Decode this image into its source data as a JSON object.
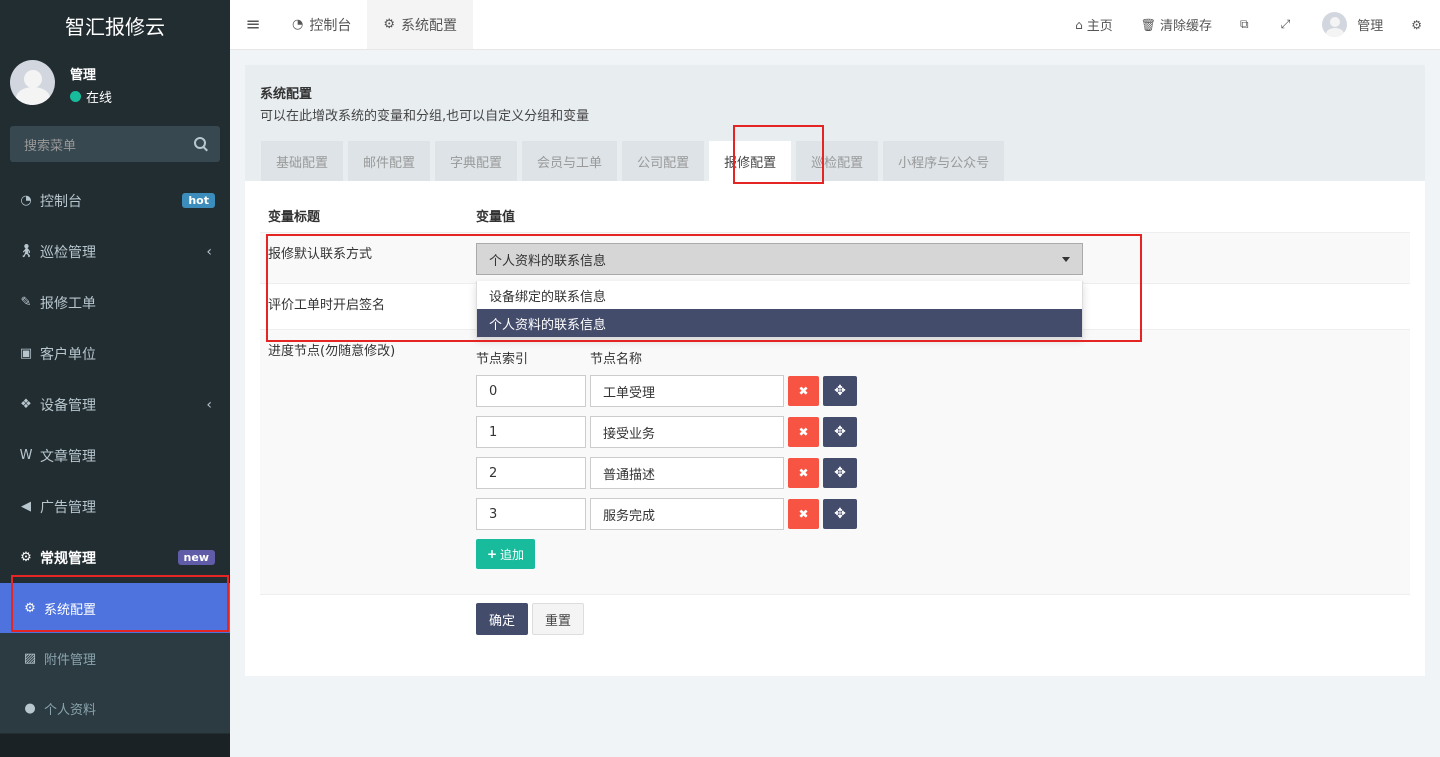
{
  "app": {
    "brand": "智汇报修云"
  },
  "user": {
    "name": "管理",
    "status": "在线"
  },
  "search": {
    "placeholder": "搜索菜单"
  },
  "sidebar": {
    "items": [
      {
        "label": "控制台",
        "badge": "hot",
        "icon": "dashboard-icon"
      },
      {
        "label": "巡检管理",
        "icon": "walk-icon"
      },
      {
        "label": "报修工单",
        "icon": "wrench-icon"
      },
      {
        "label": "客户单位",
        "icon": "contact-icon"
      },
      {
        "label": "设备管理",
        "icon": "cubes-icon"
      },
      {
        "label": "文章管理",
        "icon": "wordpress-icon"
      },
      {
        "label": "广告管理",
        "icon": "volume-icon"
      },
      {
        "label": "常规管理",
        "badge": "new",
        "icon": "gears-icon"
      }
    ],
    "subitems": [
      {
        "label": "系统配置",
        "icon": "gear-icon"
      },
      {
        "label": "附件管理",
        "icon": "image-icon"
      },
      {
        "label": "个人资料",
        "icon": "user-icon"
      }
    ]
  },
  "topbar": {
    "tabs": [
      {
        "label": "控制台",
        "icon": "dashboard-icon"
      },
      {
        "label": "系统配置",
        "icon": "gear-icon"
      }
    ],
    "home": "主页",
    "clear_cache": "清除缓存",
    "user": "管理"
  },
  "panel": {
    "title": "系统配置",
    "desc": "可以在此增改系统的变量和分组,也可以自定义分组和变量",
    "tabs": [
      "基础配置",
      "邮件配置",
      "字典配置",
      "会员与工单",
      "公司配置",
      "报修配置",
      "巡检配置",
      "小程序与公众号"
    ],
    "col_title": "变量标题",
    "col_value": "变量值",
    "rows": {
      "contact_title": "报修默认联系方式",
      "contact_value": "个人资料的联系信息",
      "sign_title": "评价工单时开启签名",
      "progress_title": "进度节点(勿随意修改)"
    },
    "dropdown": [
      "设备绑定的联系信息",
      "个人资料的联系信息"
    ],
    "node_head_index": "节点索引",
    "node_head_name": "节点名称",
    "nodes": [
      {
        "index": "0",
        "name": "工单受理"
      },
      {
        "index": "1",
        "name": "接受业务"
      },
      {
        "index": "2",
        "name": "普通描述"
      },
      {
        "index": "3",
        "name": "服务完成"
      }
    ],
    "add_label": "追加",
    "ok_label": "确定",
    "reset_label": "重置"
  }
}
